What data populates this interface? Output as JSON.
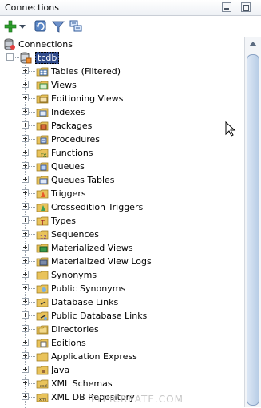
{
  "panel": {
    "title": "Connections"
  },
  "toolbar": {
    "items": [
      {
        "name": "add-connection-button",
        "icon": "plus-icon"
      },
      {
        "name": "dropdown-button",
        "icon": "dropdown-arrow-icon"
      },
      {
        "name": "refresh-button",
        "icon": "refresh-icon"
      },
      {
        "name": "filter-button",
        "icon": "filter-icon"
      },
      {
        "name": "schema-browser-button",
        "icon": "schema-icon"
      }
    ]
  },
  "tree": {
    "root_label": "Connections",
    "connection_label": "tcdb",
    "items": [
      {
        "label": "Tables (Filtered)",
        "icon": "tables-icon"
      },
      {
        "label": "Views",
        "icon": "views-icon"
      },
      {
        "label": "Editioning Views",
        "icon": "editioning-views-icon"
      },
      {
        "label": "Indexes",
        "icon": "indexes-icon"
      },
      {
        "label": "Packages",
        "icon": "packages-icon"
      },
      {
        "label": "Procedures",
        "icon": "procedures-icon"
      },
      {
        "label": "Functions",
        "icon": "functions-icon"
      },
      {
        "label": "Queues",
        "icon": "queues-icon"
      },
      {
        "label": "Queues Tables",
        "icon": "queues-tables-icon"
      },
      {
        "label": "Triggers",
        "icon": "triggers-icon"
      },
      {
        "label": "Crossedition Triggers",
        "icon": "crossedition-triggers-icon"
      },
      {
        "label": "Types",
        "icon": "types-icon"
      },
      {
        "label": "Sequences",
        "icon": "sequences-icon"
      },
      {
        "label": "Materialized Views",
        "icon": "materialized-views-icon"
      },
      {
        "label": "Materialized View Logs",
        "icon": "materialized-view-logs-icon"
      },
      {
        "label": "Synonyms",
        "icon": "synonyms-icon"
      },
      {
        "label": "Public Synonyms",
        "icon": "public-synonyms-icon"
      },
      {
        "label": "Database Links",
        "icon": "database-links-icon"
      },
      {
        "label": "Public Database Links",
        "icon": "public-database-links-icon"
      },
      {
        "label": "Directories",
        "icon": "directories-icon"
      },
      {
        "label": "Editions",
        "icon": "editions-icon"
      },
      {
        "label": "Application Express",
        "icon": "application-express-icon"
      },
      {
        "label": "Java",
        "icon": "java-icon"
      },
      {
        "label": "XML Schemas",
        "icon": "xml-schemas-icon"
      },
      {
        "label": "XML DB Repository",
        "icon": "xml-db-repository-icon"
      }
    ]
  },
  "watermark": "TYPICREATE.COM",
  "colors": {
    "selection": "#2f4a8a",
    "folder": "#e9c35b",
    "accent_green": "#2ea02e"
  }
}
